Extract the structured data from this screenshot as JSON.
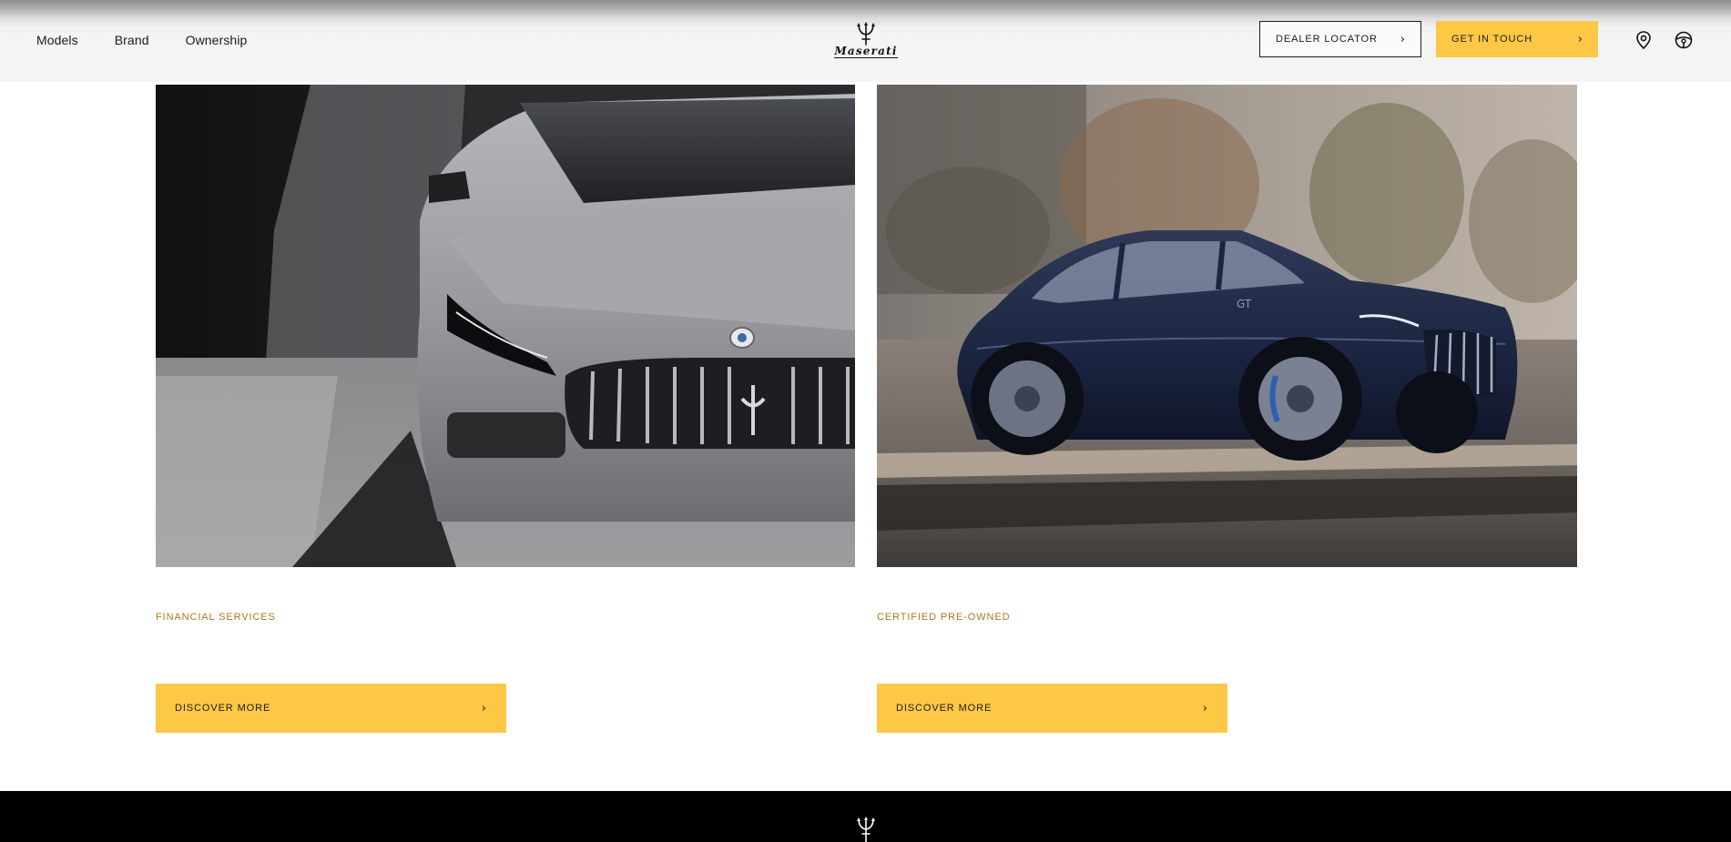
{
  "header": {
    "nav": [
      {
        "label": "Models"
      },
      {
        "label": "Brand"
      },
      {
        "label": "Ownership"
      }
    ],
    "logo_text": "Maserati",
    "dealer_locator_label": "DEALER LOCATOR",
    "get_in_touch_label": "GET IN TOUCH",
    "icons": [
      "location-pin-icon",
      "steering-wheel-icon"
    ]
  },
  "cards": [
    {
      "label": "FINANCIAL SERVICES",
      "cta": "DISCOVER MORE",
      "image": "silver sedan front view"
    },
    {
      "label": "CERTIFIED PRE-OWNED",
      "cta": "DISCOVER MORE",
      "image": "dark blue SUV driving"
    }
  ],
  "colors": {
    "accent": "#fdc845",
    "label_gold": "#a87b1f",
    "footer_bg": "#000000"
  }
}
